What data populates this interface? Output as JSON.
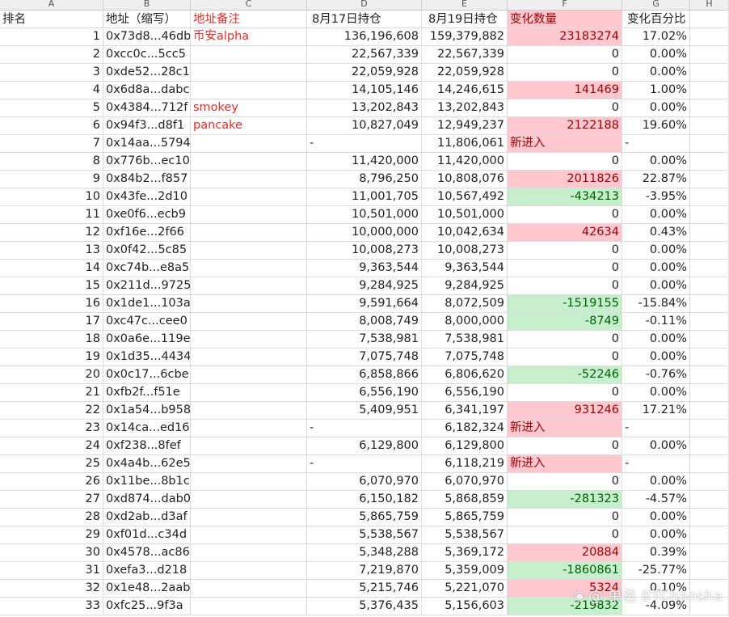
{
  "columns": [
    "A",
    "B",
    "C",
    "D",
    "E",
    "F",
    "G",
    "H"
  ],
  "header": {
    "rank": "排名",
    "address": "地址（缩写）",
    "note": "地址备注",
    "aug17": "8月17日持仓",
    "aug19": "8月19日持仓",
    "change": "变化数量",
    "pct": "变化百分比"
  },
  "rows": [
    {
      "rank": "1",
      "address": "0x73d8...46db",
      "note": "币安alpha",
      "aug17": "136,196,608",
      "aug19": "159,379,882",
      "change": "23183274",
      "pct": "17.02%",
      "status": "pos"
    },
    {
      "rank": "2",
      "address": "0xcc0c...5cc5",
      "note": "",
      "aug17": "22,567,339",
      "aug19": "22,567,339",
      "change": "0",
      "pct": "0.00%",
      "status": "zero"
    },
    {
      "rank": "3",
      "address": "0xde52...28c1",
      "note": "",
      "aug17": "22,059,928",
      "aug19": "22,059,928",
      "change": "0",
      "pct": "0.00%",
      "status": "zero"
    },
    {
      "rank": "4",
      "address": "0x6d8a...dabc",
      "note": "",
      "aug17": "14,105,146",
      "aug19": "14,246,615",
      "change": "141469",
      "pct": "1.00%",
      "status": "pos"
    },
    {
      "rank": "5",
      "address": "0x4384...712f",
      "note": "smokey",
      "aug17": "13,202,843",
      "aug19": "13,202,843",
      "change": "0",
      "pct": "0.00%",
      "status": "zero"
    },
    {
      "rank": "6",
      "address": "0x94f3...d8f1",
      "note": "pancake",
      "aug17": "10,827,049",
      "aug19": "12,949,237",
      "change": "2122188",
      "pct": "19.60%",
      "status": "pos"
    },
    {
      "rank": "7",
      "address": "0x14aa...5794",
      "note": "",
      "aug17": "-",
      "aug19": "11,806,061",
      "change": "新进入",
      "pct": "-",
      "status": "new"
    },
    {
      "rank": "8",
      "address": "0x776b...ec10",
      "note": "",
      "aug17": "11,420,000",
      "aug19": "11,420,000",
      "change": "0",
      "pct": "0.00%",
      "status": "zero"
    },
    {
      "rank": "9",
      "address": "0x84b2...f857",
      "note": "",
      "aug17": "8,796,250",
      "aug19": "10,808,076",
      "change": "2011826",
      "pct": "22.87%",
      "status": "pos"
    },
    {
      "rank": "10",
      "address": "0x43fe...2d10",
      "note": "",
      "aug17": "11,001,705",
      "aug19": "10,567,492",
      "change": "-434213",
      "pct": "-3.95%",
      "status": "neg"
    },
    {
      "rank": "11",
      "address": "0xe0f6...ecb9",
      "note": "",
      "aug17": "10,501,000",
      "aug19": "10,501,000",
      "change": "0",
      "pct": "0.00%",
      "status": "zero"
    },
    {
      "rank": "12",
      "address": "0xf16e...2f66",
      "note": "",
      "aug17": "10,000,000",
      "aug19": "10,042,634",
      "change": "42634",
      "pct": "0.43%",
      "status": "pos"
    },
    {
      "rank": "13",
      "address": "0x0f42...5c85",
      "note": "",
      "aug17": "10,008,273",
      "aug19": "10,008,273",
      "change": "0",
      "pct": "0.00%",
      "status": "zero"
    },
    {
      "rank": "14",
      "address": "0xc74b...e8a5",
      "note": "",
      "aug17": "9,363,544",
      "aug19": "9,363,544",
      "change": "0",
      "pct": "0.00%",
      "status": "zero"
    },
    {
      "rank": "15",
      "address": "0x211d...9725",
      "note": "",
      "aug17": "9,284,925",
      "aug19": "9,284,925",
      "change": "0",
      "pct": "0.00%",
      "status": "zero"
    },
    {
      "rank": "16",
      "address": "0x1de1...103a",
      "note": "",
      "aug17": "9,591,664",
      "aug19": "8,072,509",
      "change": "-1519155",
      "pct": "-15.84%",
      "status": "neg"
    },
    {
      "rank": "17",
      "address": "0xc47c...cee0",
      "note": "",
      "aug17": "8,008,749",
      "aug19": "8,000,000",
      "change": "-8749",
      "pct": "-0.11%",
      "status": "neg"
    },
    {
      "rank": "18",
      "address": "0x0a6e...119e",
      "note": "",
      "aug17": "7,538,981",
      "aug19": "7,538,981",
      "change": "0",
      "pct": "0.00%",
      "status": "zero"
    },
    {
      "rank": "19",
      "address": "0x1d35...4434",
      "note": "",
      "aug17": "7,075,748",
      "aug19": "7,075,748",
      "change": "0",
      "pct": "0.00%",
      "status": "zero"
    },
    {
      "rank": "20",
      "address": "0x0c17...6cbe",
      "note": "",
      "aug17": "6,858,866",
      "aug19": "6,806,620",
      "change": "-52246",
      "pct": "-0.76%",
      "status": "neg"
    },
    {
      "rank": "21",
      "address": "0xfb2f...f51e",
      "note": "",
      "aug17": "6,556,190",
      "aug19": "6,556,190",
      "change": "0",
      "pct": "0.00%",
      "status": "zero"
    },
    {
      "rank": "22",
      "address": "0x1a54...b958",
      "note": "",
      "aug17": "5,409,951",
      "aug19": "6,341,197",
      "change": "931246",
      "pct": "17.21%",
      "status": "pos"
    },
    {
      "rank": "23",
      "address": "0x14ca...ed16",
      "note": "",
      "aug17": "-",
      "aug19": "6,182,324",
      "change": "新进入",
      "pct": "-",
      "status": "new"
    },
    {
      "rank": "24",
      "address": "0xf238...8fef",
      "note": "",
      "aug17": "6,129,800",
      "aug19": "6,129,800",
      "change": "0",
      "pct": "0.00%",
      "status": "zero"
    },
    {
      "rank": "25",
      "address": "0x4a4b...62e5",
      "note": "",
      "aug17": "-",
      "aug19": "6,118,219",
      "change": "新进入",
      "pct": "-",
      "status": "new"
    },
    {
      "rank": "26",
      "address": "0x11be...8b1c",
      "note": "",
      "aug17": "6,070,970",
      "aug19": "6,070,970",
      "change": "0",
      "pct": "0.00%",
      "status": "zero"
    },
    {
      "rank": "27",
      "address": "0xd874...dab0",
      "note": "",
      "aug17": "6,150,182",
      "aug19": "5,868,859",
      "change": "-281323",
      "pct": "-4.57%",
      "status": "neg"
    },
    {
      "rank": "28",
      "address": "0xd2ab...d3af",
      "note": "",
      "aug17": "5,865,759",
      "aug19": "5,865,759",
      "change": "0",
      "pct": "0.00%",
      "status": "zero"
    },
    {
      "rank": "29",
      "address": "0xf01d...c34d",
      "note": "",
      "aug17": "5,538,567",
      "aug19": "5,538,567",
      "change": "0",
      "pct": "0.00%",
      "status": "zero"
    },
    {
      "rank": "30",
      "address": "0x4578...ac86",
      "note": "",
      "aug17": "5,348,288",
      "aug19": "5,369,172",
      "change": "20884",
      "pct": "0.39%",
      "status": "pos"
    },
    {
      "rank": "31",
      "address": "0xefa3...d218",
      "note": "",
      "aug17": "7,219,870",
      "aug19": "5,359,009",
      "change": "-1860861",
      "pct": "-25.77%",
      "status": "neg"
    },
    {
      "rank": "32",
      "address": "0x1e48...2aab",
      "note": "",
      "aug17": "5,215,746",
      "aug19": "5,221,070",
      "change": "5324",
      "pct": "0.10%",
      "status": "pos"
    },
    {
      "rank": "33",
      "address": "0xfc25...9f3a",
      "note": "",
      "aug17": "5,376,435",
      "aug19": "5,156,603",
      "change": "-219832",
      "pct": "-4.09%",
      "status": "neg"
    }
  ],
  "watermark": {
    "icon": "weibo-icon",
    "text": "@ 单爸 BTChansha"
  },
  "colors": {
    "pos_bg": "#ffc7ce",
    "neg_bg": "#c6efce",
    "note_red": "#e0312b"
  }
}
